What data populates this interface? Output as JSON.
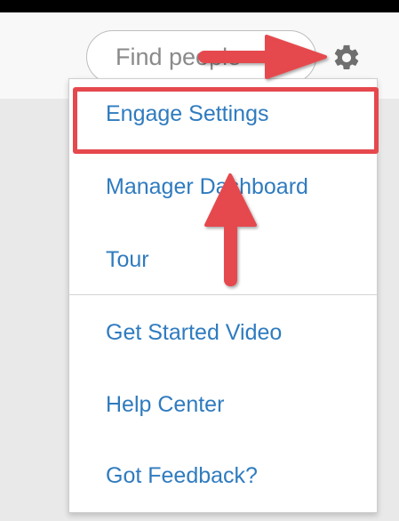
{
  "search": {
    "placeholder": "Find people"
  },
  "icons": {
    "settings": "gear-icon"
  },
  "menu": {
    "items": [
      {
        "label": "Engage Settings"
      },
      {
        "label": "Manager Dashboard"
      },
      {
        "label": "Tour"
      },
      {
        "label": "Get Started Video"
      },
      {
        "label": "Help Center"
      },
      {
        "label": "Got Feedback?"
      }
    ]
  },
  "colors": {
    "link": "#2f7bbf",
    "annotation": "#e5484d"
  }
}
